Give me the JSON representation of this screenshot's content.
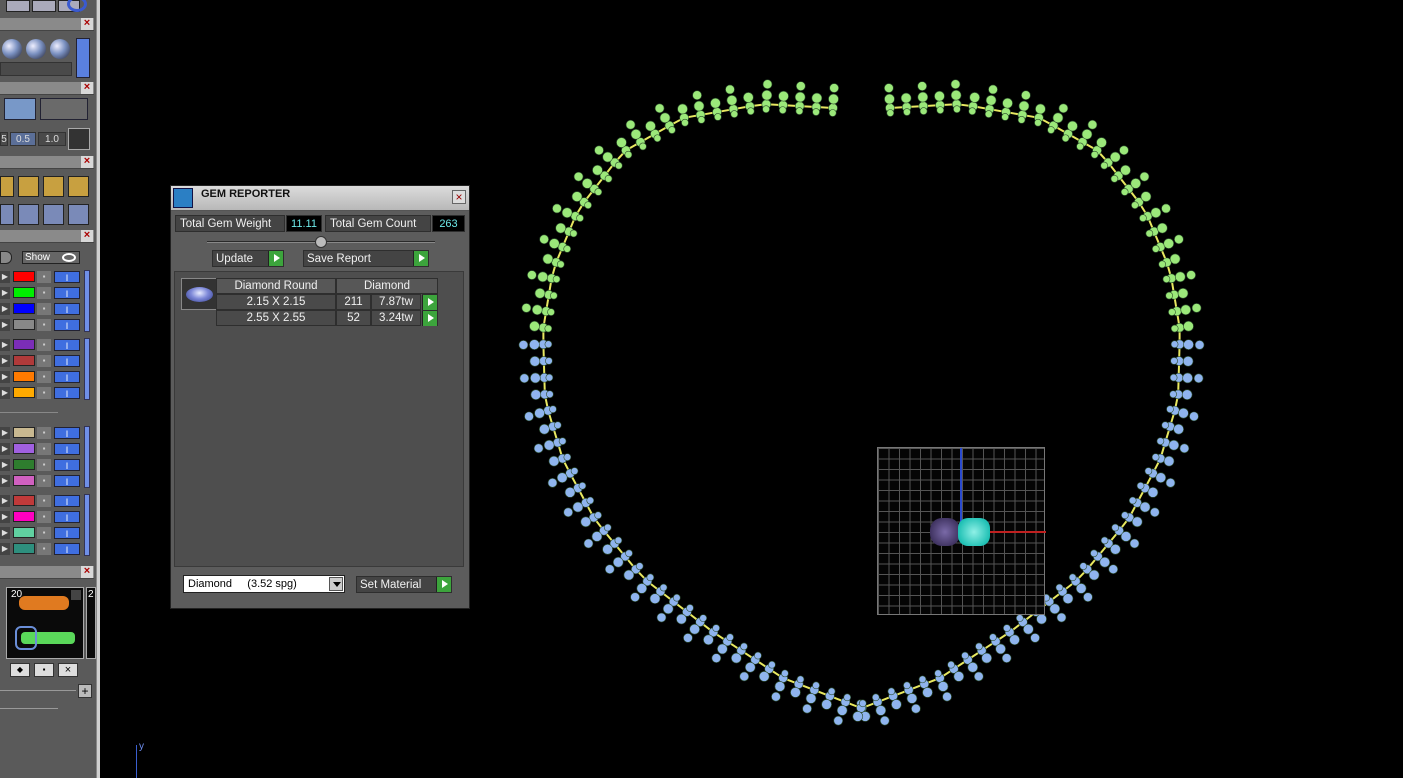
{
  "left_panel": {
    "snap_values": [
      "5",
      "0.5",
      "1.0"
    ],
    "show_label": "Show",
    "layer_colors": [
      "#ff0000",
      "#00ee00",
      "#0000ff",
      "#888888",
      "#7b2db8",
      "#b03a3a",
      "#ff7a00",
      "#ffaa00",
      "#c8b890",
      "#a060e0",
      "#2e7d2e",
      "#d060c0",
      "#c03a3a",
      "#ff00c0",
      "#60d0a0",
      "#2e8f7e"
    ],
    "thumbnail_number": "20",
    "thumbnail_number_2": "2"
  },
  "gem_reporter": {
    "title": "GEM REPORTER",
    "total_weight_label": "Total Gem Weight",
    "total_weight_value": "11.11",
    "total_count_label": "Total Gem Count",
    "total_count_value": "263",
    "update_label": "Update",
    "save_report_label": "Save Report",
    "shape_header": "Diamond Round",
    "material_header": "Diamond",
    "rows": [
      {
        "size": "2.15 X 2.15",
        "count": "211",
        "weight": "7.87tw"
      },
      {
        "size": "2.55 X 2.55",
        "count": "52",
        "weight": "3.24tw"
      }
    ],
    "material_select": "Diamond     (3.52 spg)",
    "set_material_label": "Set Material"
  },
  "viewport": {
    "axis_label": "y",
    "colors": {
      "green_gems": "#9be87a",
      "blue_gems": "#8fb4ee",
      "prongs": "#e8e860",
      "gizmo_teal": "#30d8c8",
      "gizmo_purple": "#5a4a8a"
    }
  }
}
